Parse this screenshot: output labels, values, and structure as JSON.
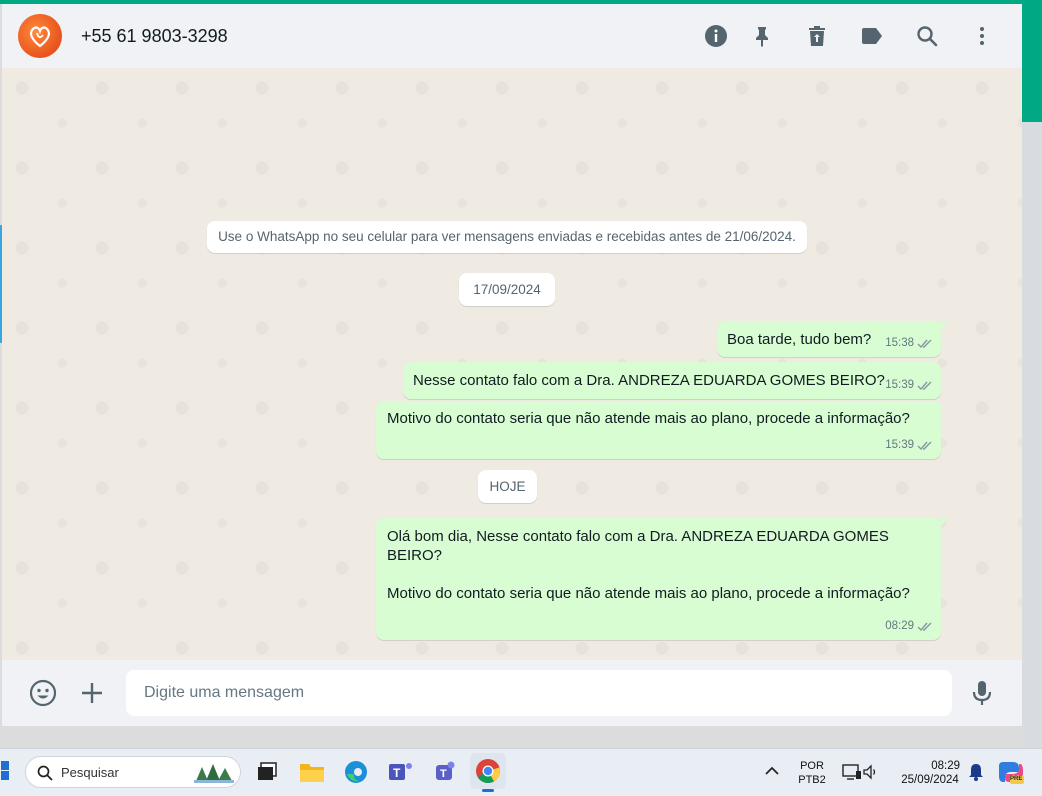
{
  "colors": {
    "accent": "#00a884",
    "header_bg": "#f0f2f5",
    "chat_bg": "#efeae2",
    "outgoing_bubble": "#d9fdd3",
    "read_ticks": "#667781"
  },
  "header": {
    "contact_name": "+55 61 9803-3298",
    "icons": [
      "info-icon",
      "pin-icon",
      "delete-icon",
      "label-icon",
      "search-icon",
      "more-menu-icon"
    ]
  },
  "chat": {
    "system_notice": "Use o WhatsApp no seu celular para ver mensagens enviadas e recebidas antes de 21/06/2024.",
    "date_chip_1": "17/09/2024",
    "date_chip_2": "HOJE",
    "messages": [
      {
        "text": "Boa tarde, tudo bem?",
        "time": "15:38"
      },
      {
        "text": "Nesse contato falo com a Dra. ANDREZA EDUARDA GOMES BEIRO?",
        "time": "15:39"
      },
      {
        "text": "Motivo do contato seria que não atende mais ao plano, procede a informação?",
        "time": "15:39"
      },
      {
        "text": "Olá bom dia, Nesse contato falo com a Dra. ANDREZA EDUARDA GOMES BEIRO?\n\nMotivo do contato seria que não atende mais ao plano, procede a informação?",
        "time": "08:29"
      }
    ]
  },
  "composer": {
    "placeholder": "Digite uma mensagem"
  },
  "taskbar": {
    "search_label": "Pesquisar",
    "language_line1": "POR",
    "language_line2": "PTB2",
    "clock_time": "08:29",
    "clock_date": "25/09/2024",
    "copilot_badge": "PRE"
  }
}
